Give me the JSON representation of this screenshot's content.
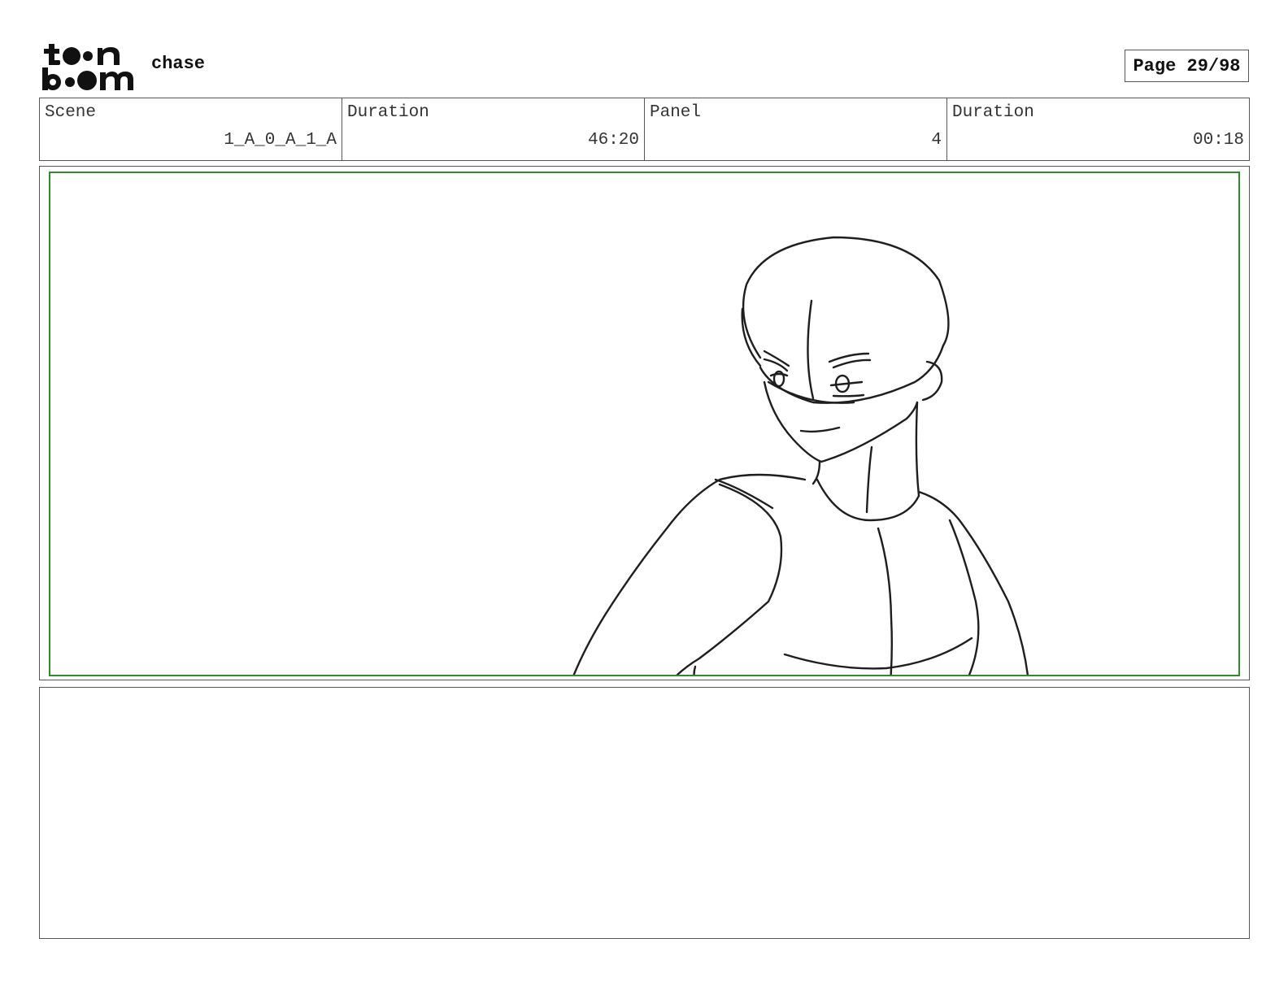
{
  "header": {
    "logo": {
      "icon": "toon-boom-logo",
      "line1": "toon",
      "line2": "boom"
    },
    "title": "chase",
    "page_label": "Page",
    "page_value": "29/98"
  },
  "info": {
    "scene_label": "Scene",
    "scene_value": "1_A_0_A_1_A",
    "scene_duration_label": "Duration",
    "scene_duration_value": "46:20",
    "panel_label": "Panel",
    "panel_value": "4",
    "panel_duration_label": "Duration",
    "panel_duration_value": "00:18"
  },
  "panel": {
    "image": "sketch-character-bob-hair-looking-down",
    "safe_area_color": "#2e8b2e"
  },
  "notes": {
    "text": ""
  }
}
